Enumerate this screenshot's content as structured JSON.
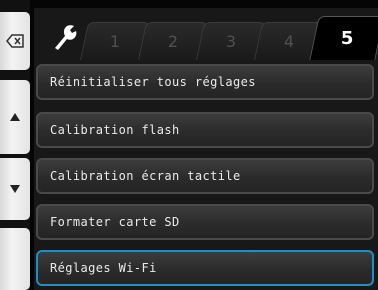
{
  "side": {
    "back_icon": "backspace-icon",
    "up_icon": "triangle-up-icon",
    "down_icon": "triangle-down-icon"
  },
  "tabs": {
    "settings_icon": "wrench-icon",
    "t1": "1",
    "t2": "2",
    "t3": "3",
    "t4": "4",
    "t5": "5",
    "active": "5"
  },
  "menu": {
    "items": [
      {
        "label": "Réinitialiser tous réglages"
      },
      {
        "label": "Calibration flash"
      },
      {
        "label": "Calibration écran tactile"
      },
      {
        "label": "Formater carte SD"
      },
      {
        "label": "Réglages Wi-Fi"
      }
    ],
    "highlight_color": "#1d8fc4"
  }
}
